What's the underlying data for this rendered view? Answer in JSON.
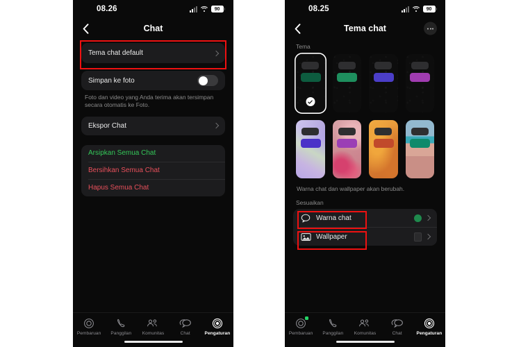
{
  "meta": {
    "app": "WhatsApp",
    "page_bg": "#ffffff",
    "phone_bg": "#0a0a0a",
    "card_bg": "#1c1c1e",
    "highlight_color": "#ee1111",
    "accent_green": "#34c759",
    "accent_red": "#e8505b",
    "brand_green": "#25d366"
  },
  "left_phone": {
    "statusbar": {
      "time": "08.26",
      "battery": "90",
      "signal_icon": "signal-bars-icon",
      "wifi_icon": "wifi-icon",
      "battery_icon": "battery-icon"
    },
    "navbar": {
      "title": "Chat",
      "back_icon": "chevron-left-icon"
    },
    "rows": {
      "default_theme": {
        "label": "Tema chat default",
        "chevron": "chevron-right-icon",
        "highlighted": true
      },
      "save_to_photos": {
        "label": "Simpan ke foto",
        "toggle_state": "off"
      },
      "save_to_photos_hint": "Foto dan video yang Anda terima akan tersimpan secara otomatis ke Foto.",
      "export_chat": {
        "label": "Ekspor Chat",
        "chevron": "chevron-right-icon"
      }
    },
    "actions": [
      {
        "label": "Arsipkan Semua Chat",
        "color": "green"
      },
      {
        "label": "Bersihkan Semua Chat",
        "color": "red"
      },
      {
        "label": "Hapus Semua Chat",
        "color": "red"
      }
    ],
    "tabs": [
      {
        "label": "Pembaruan",
        "icon": "updates-icon",
        "active": false,
        "badge": false
      },
      {
        "label": "Panggilan",
        "icon": "calls-icon",
        "active": false,
        "badge": false
      },
      {
        "label": "Komunitas",
        "icon": "communities-icon",
        "active": false,
        "badge": false
      },
      {
        "label": "Chat",
        "icon": "chats-icon",
        "active": false,
        "badge": false
      },
      {
        "label": "Pengaturan",
        "icon": "settings-gear-icon",
        "active": true,
        "badge": false
      }
    ]
  },
  "right_phone": {
    "statusbar": {
      "time": "08.25",
      "battery": "90",
      "signal_icon": "signal-bars-icon",
      "wifi_icon": "wifi-icon",
      "battery_icon": "battery-icon"
    },
    "navbar": {
      "title": "Tema chat",
      "back_icon": "chevron-left-icon",
      "more_icon": "more-options-icon"
    },
    "theme_section_label": "Tema",
    "themes": [
      {
        "name": "Default gelap hijau tua",
        "style": "dark",
        "bubble_color": "#0d5c3f",
        "selected": true
      },
      {
        "name": "Gelap hijau",
        "style": "dark",
        "bubble_color": "#1e8f5e",
        "selected": false
      },
      {
        "name": "Gelap indigo",
        "style": "dark",
        "bubble_color": "#4b3ec8",
        "selected": false
      },
      {
        "name": "Gelap ungu",
        "style": "dark",
        "bubble_color": "#a03cb0",
        "selected": false
      },
      {
        "name": "Wallpaper iridescent",
        "style": "wp-iridescent",
        "bubble_color": "#4b32c8",
        "selected": false
      },
      {
        "name": "Wallpaper floral",
        "style": "wp-floral",
        "bubble_color": "#9b3fb5",
        "selected": false
      },
      {
        "name": "Wallpaper oranye",
        "style": "wp-orange",
        "bubble_color": "#c1492b",
        "selected": false
      },
      {
        "name": "Wallpaper pantai",
        "style": "wp-beach",
        "bubble_color": "#0f8a6b",
        "selected": false
      }
    ],
    "theme_hint": "Warna chat dan wallpaper akan berubah.",
    "customize_label": "Sesuaikan",
    "customize_rows": [
      {
        "label": "Warna chat",
        "icon": "chat-bubble-icon",
        "value_swatch": "#1f8a4d",
        "value_type": "color-dot",
        "chevron": "chevron-right-icon",
        "highlighted": true
      },
      {
        "label": "Wallpaper",
        "icon": "image-icon",
        "value_swatch": "#2a2a2c",
        "value_type": "thumbnail",
        "chevron": "chevron-right-icon",
        "highlighted": true
      }
    ],
    "tabs": [
      {
        "label": "Pembaruan",
        "icon": "updates-icon",
        "active": false,
        "badge": true
      },
      {
        "label": "Panggilan",
        "icon": "calls-icon",
        "active": false,
        "badge": false
      },
      {
        "label": "Komunitas",
        "icon": "communities-icon",
        "active": false,
        "badge": false
      },
      {
        "label": "Chat",
        "icon": "chats-icon",
        "active": false,
        "badge": false
      },
      {
        "label": "Pengaturan",
        "icon": "settings-gear-icon",
        "active": true,
        "badge": false
      }
    ]
  }
}
